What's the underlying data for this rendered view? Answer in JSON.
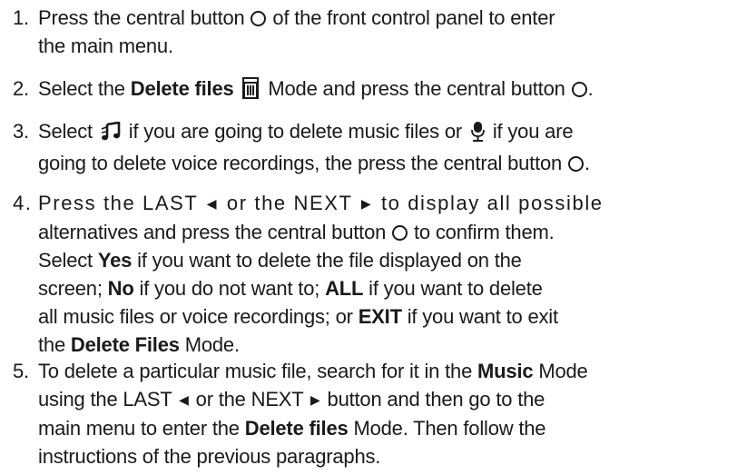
{
  "steps": [
    {
      "num": "1.",
      "l1_a": "Press the central button",
      "l1_b": "of the front control panel to enter",
      "l2": "the main menu."
    },
    {
      "num": "2.",
      "a": "Select the",
      "b_bold": "Delete files",
      "c": "Mode and press the central button",
      "d": "."
    },
    {
      "num": "3.",
      "l1_a": "Select",
      "l1_b": "if you are going to delete music files or",
      "l1_c": "if you are",
      "l2_a": "going to delete voice recordings, the press the central button",
      "l2_b": "."
    },
    {
      "num": "4.",
      "l1_a": "Press the LAST",
      "l1_b": "or the NEXT",
      "l1_c": "to display all possible",
      "l2_a": "alternatives and press the central button",
      "l2_b": "to confirm them.",
      "l3_a": "Select",
      "l3_b": "Yes",
      "l3_c": "if you want to delete the file displayed on the",
      "l4_a": "screen;",
      "l4_b": "No",
      "l4_c": "if you do not want to;",
      "l4_d": "ALL",
      "l4_e": "if you want to delete",
      "l5_a": "all music files or voice recordings; or",
      "l5_b": "EXIT",
      "l5_c": "if you want to exit",
      "l6_a": "the",
      "l6_b": "Delete Files",
      "l6_c": "Mode."
    },
    {
      "num": "5.",
      "l1_a": "To delete a particular music file, search for it in the",
      "l1_b": "Music",
      "l1_c": "Mode",
      "l2_a": "using the LAST",
      "l2_b": "or the NEXT",
      "l2_c": "button and then go to the",
      "l3_a": "main menu to enter the",
      "l3_b": "Delete files",
      "l3_c": "Mode. Then follow the",
      "l4": "instructions of the previous paragraphs."
    }
  ],
  "icons": {
    "circle": "central-button-circle",
    "trash": "delete-files-icon",
    "music": "music-note-icon",
    "voice": "microphone-icon",
    "left_triangle": "◀",
    "right_triangle": "▶"
  }
}
